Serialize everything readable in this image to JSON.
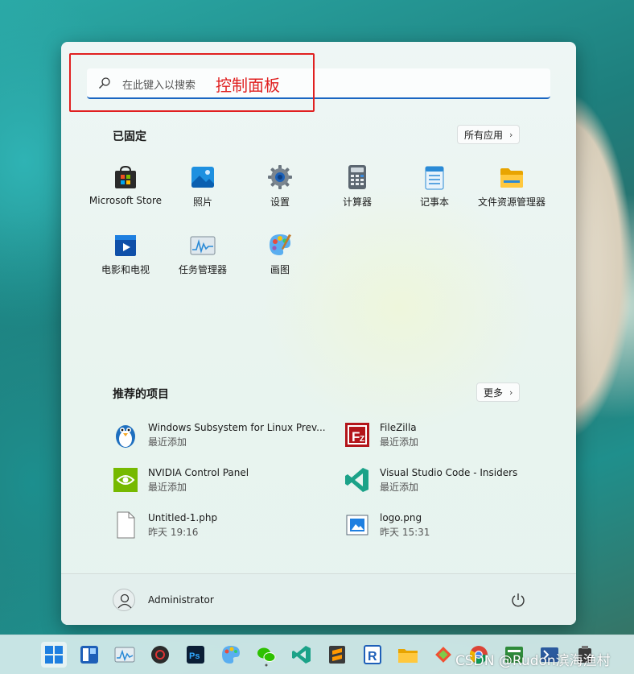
{
  "search": {
    "placeholder": "在此键入以搜索",
    "typed": "控制面板"
  },
  "pinned": {
    "title": "已固定",
    "all_apps": "所有应用",
    "apps": [
      {
        "label": "Microsoft Store",
        "icon": "store-icon"
      },
      {
        "label": "照片",
        "icon": "photos-icon"
      },
      {
        "label": "设置",
        "icon": "settings-gear-icon"
      },
      {
        "label": "计算器",
        "icon": "calculator-icon"
      },
      {
        "label": "记事本",
        "icon": "notepad-icon"
      },
      {
        "label": "文件资源管理器",
        "icon": "folder-icon"
      },
      {
        "label": "电影和电视",
        "icon": "movies-tv-icon"
      },
      {
        "label": "任务管理器",
        "icon": "task-manager-icon"
      },
      {
        "label": "画图",
        "icon": "paint-palette-icon"
      }
    ]
  },
  "recommended": {
    "title": "推荐的项目",
    "more": "更多",
    "items": [
      {
        "name": "Windows Subsystem for Linux Prev...",
        "sub": "最近添加",
        "icon": "linux-penguin-icon"
      },
      {
        "name": "FileZilla",
        "sub": "最近添加",
        "icon": "filezilla-icon"
      },
      {
        "name": "NVIDIA Control Panel",
        "sub": "最近添加",
        "icon": "nvidia-icon"
      },
      {
        "name": "Visual Studio Code - Insiders",
        "sub": "最近添加",
        "icon": "vscode-insiders-icon"
      },
      {
        "name": "Untitled-1.php",
        "sub": "昨天 19:16",
        "icon": "file-icon"
      },
      {
        "name": "logo.png",
        "sub": "昨天 15:31",
        "icon": "image-file-icon"
      }
    ]
  },
  "user": {
    "name": "Administrator"
  },
  "taskbar": {
    "icons": [
      "windows-start-icon",
      "widgets-icon",
      "task-manager-icon",
      "netease-music-icon",
      "photoshop-icon",
      "paint-icon",
      "wechat-icon",
      "vscode-icon",
      "sublime-icon",
      "rstudio-icon",
      "file-explorer-icon",
      "git-icon",
      "chrome-icon",
      "app-icon",
      "powershell-icon",
      "app2-icon"
    ]
  },
  "watermark": "CSDN @Rudon滨海渔村",
  "colors": {
    "accent": "#1a66c2",
    "annotation_red": "#e02020"
  }
}
